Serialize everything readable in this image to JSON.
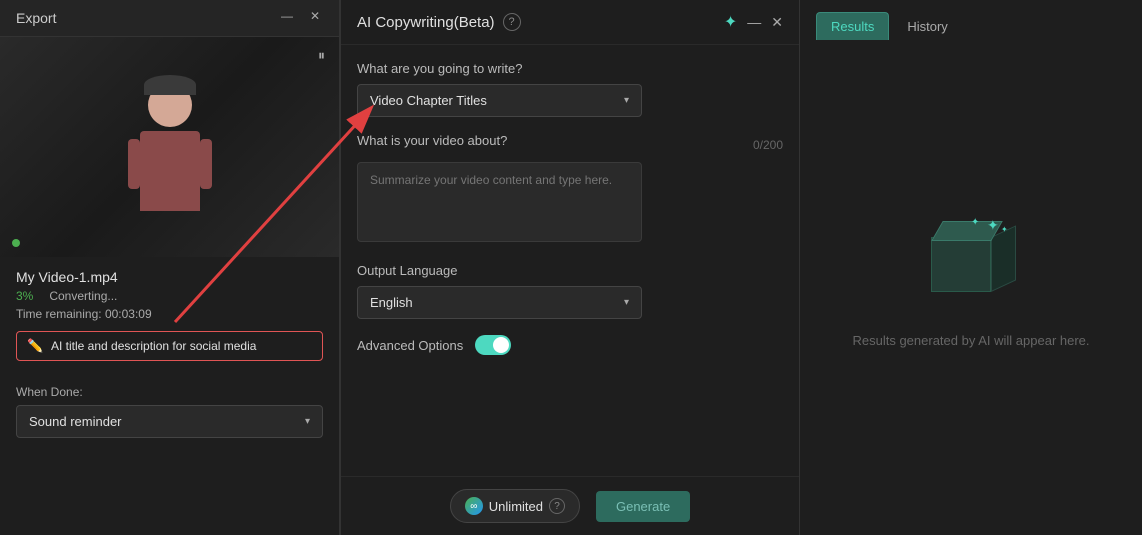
{
  "app": {
    "title": "Export"
  },
  "window_controls": {
    "minimize": "—",
    "close": "✕"
  },
  "video": {
    "filename": "My Video-1.mp4",
    "percent": "3%",
    "status": "Converting...",
    "time_remaining_label": "Time remaining:",
    "time_remaining": "00:03:09",
    "pause_icon": "⏸"
  },
  "ai_suggestion": {
    "label": "AI title and description for social media"
  },
  "when_done": {
    "label": "When Done:",
    "value": "Sound reminder"
  },
  "ai_panel": {
    "title": "AI Copywriting(Beta)",
    "help": "?",
    "tabs": {
      "results": "Results",
      "history": "History"
    },
    "form": {
      "write_label": "What are you going to write?",
      "write_placeholder": "Video Chapter Titles",
      "about_label": "What is your video about?",
      "char_count": "0/200",
      "about_placeholder": "Summarize your video content and type here.",
      "output_language_label": "Output Language",
      "output_language_value": "English",
      "advanced_options_label": "Advanced Options"
    },
    "footer": {
      "unlimited_label": "Unlimited",
      "generate_label": "Generate"
    },
    "results": {
      "empty_text": "Results generated by AI will appear here."
    }
  }
}
